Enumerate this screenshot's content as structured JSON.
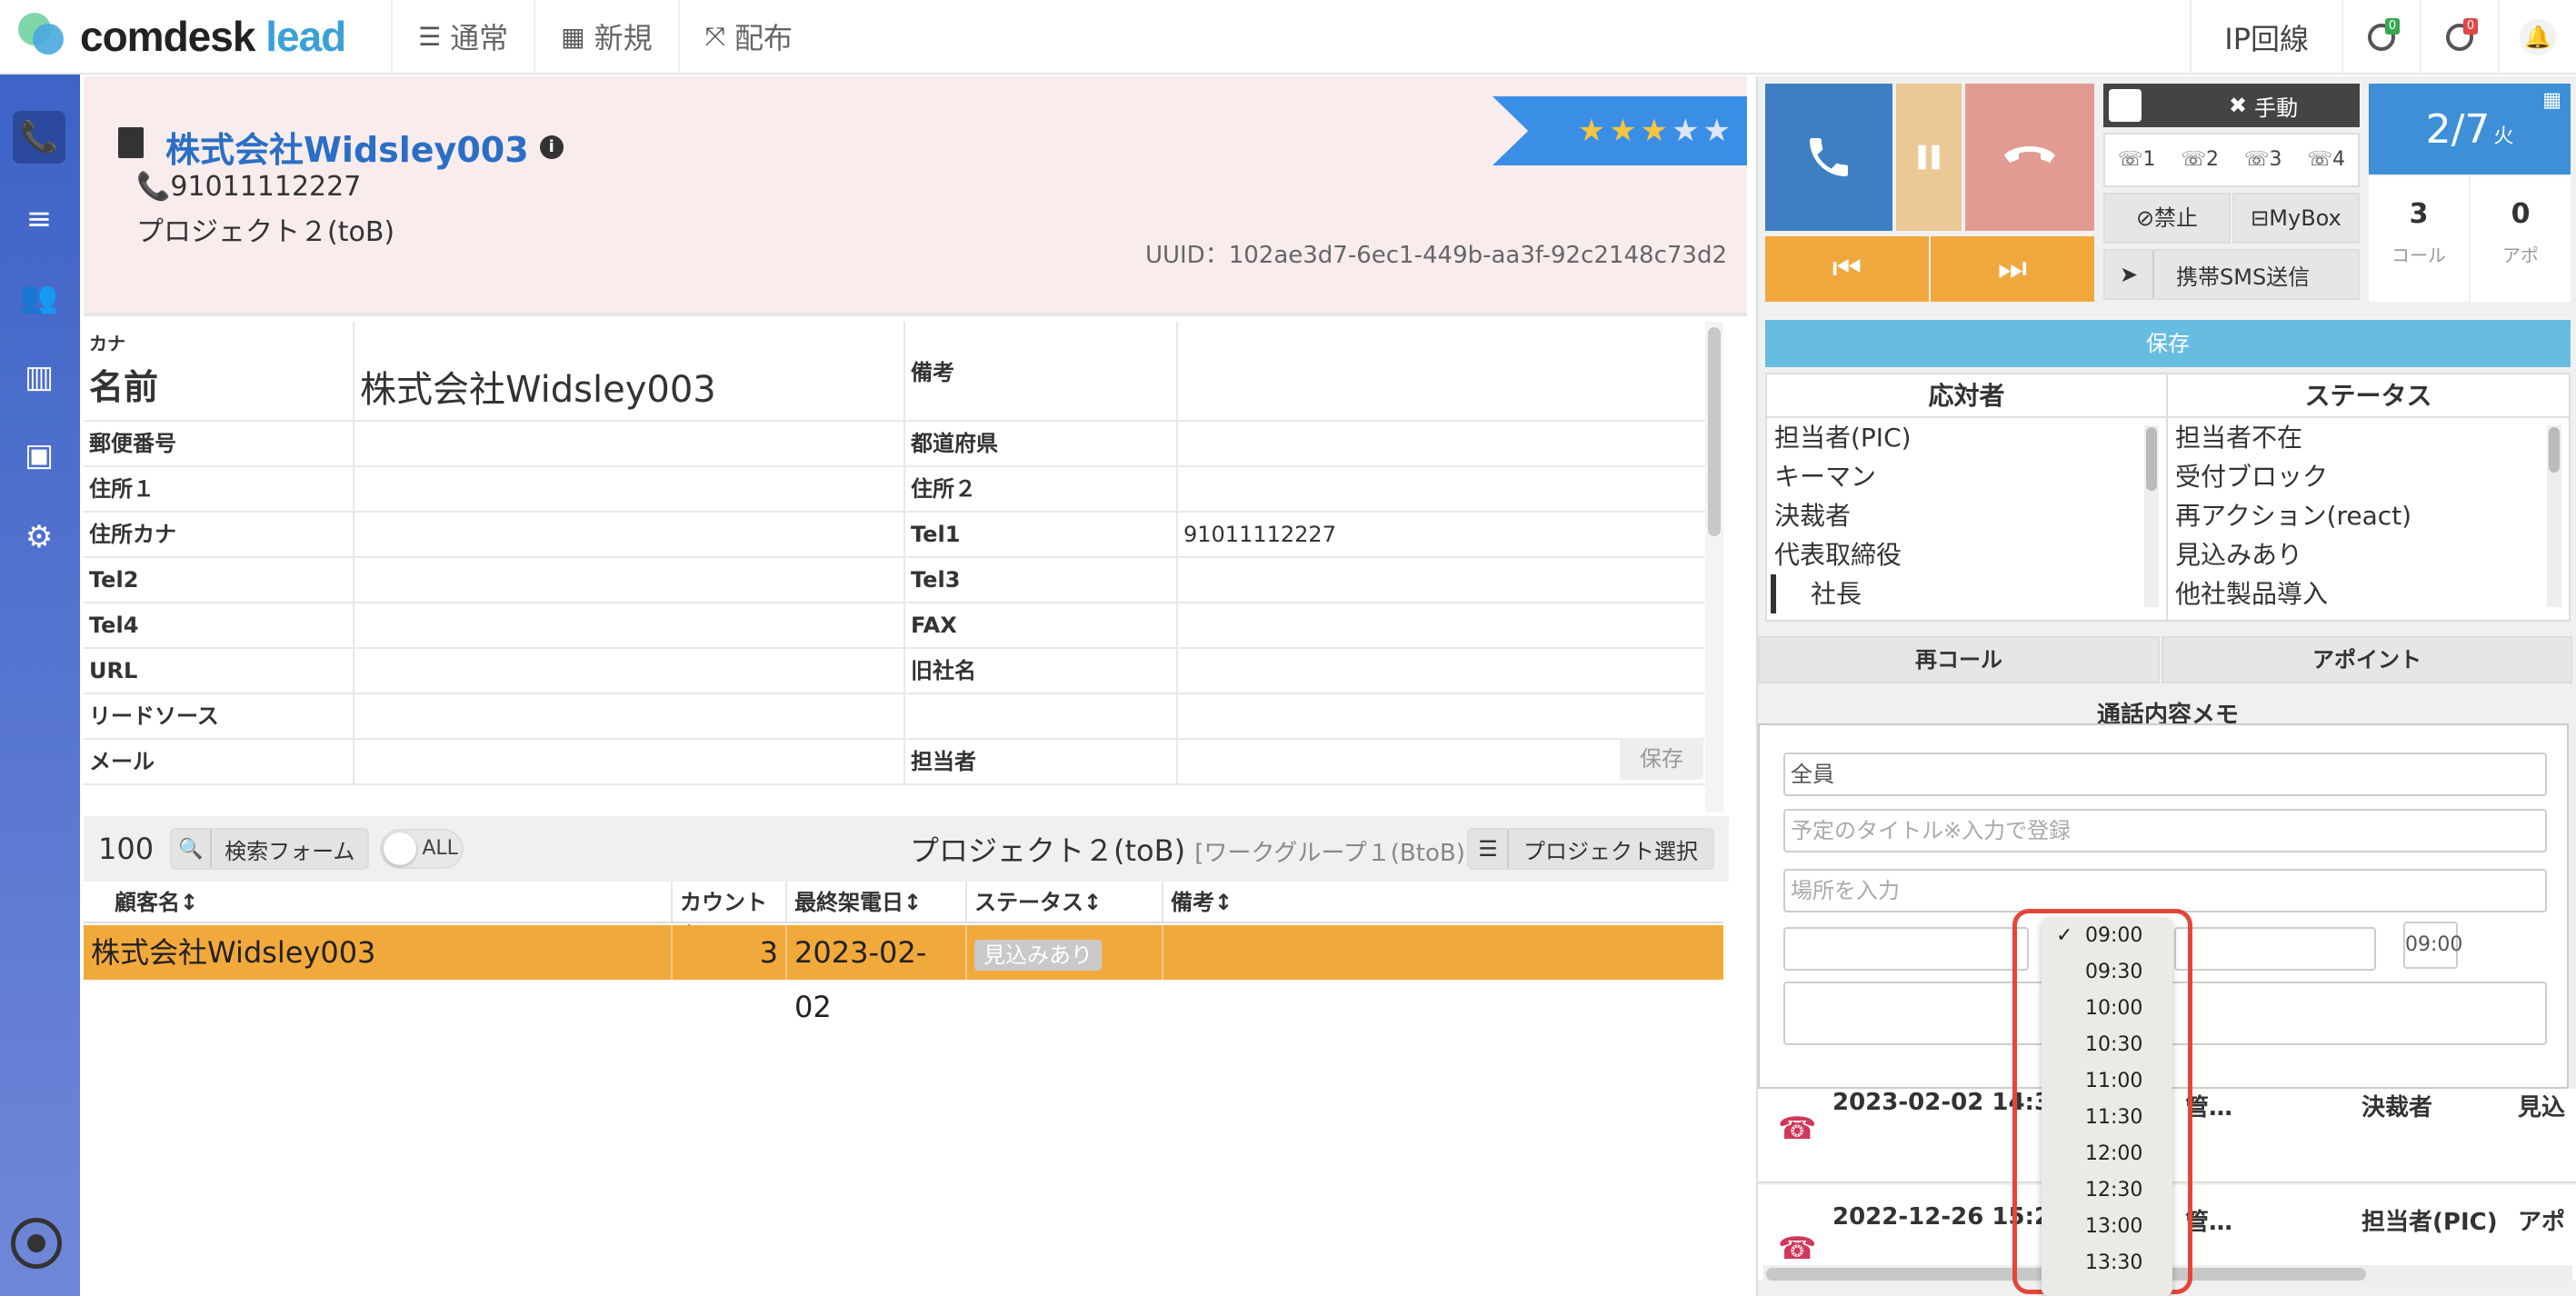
{
  "header": {
    "logo": {
      "comdesk": "comdesk",
      "lead": "lead"
    },
    "nav": [
      {
        "label": "通常",
        "icon": "list-icon"
      },
      {
        "label": "新規",
        "icon": "grid-icon"
      },
      {
        "label": "配布",
        "icon": "expand-icon"
      }
    ],
    "ip_line": "IP回線",
    "badges": [
      "0",
      "0"
    ],
    "colors": {
      "badge1": "#3aa851",
      "badge2": "#e04747"
    }
  },
  "company": {
    "name": "株式会社Widsley003",
    "tel": "91011112227",
    "project": "プロジェクト２(toB)",
    "uuid": "UUID：102ae3d7-6ec1-449b-aa3f-92c2148c73d2",
    "rating": 3,
    "rating_max": 5
  },
  "details": {
    "kana_label": "カナ",
    "name_label": "名前",
    "name_value": "株式会社Widsley003",
    "rows": [
      {
        "l1": "備考",
        "v1": "",
        "l2": "",
        "v2": ""
      },
      {
        "l1": "郵便番号",
        "v1": "",
        "l2": "都道府県",
        "v2": ""
      },
      {
        "l1": "住所１",
        "v1": "",
        "l2": "住所２",
        "v2": ""
      },
      {
        "l1": "住所カナ",
        "v1": "",
        "l2": "Tel1",
        "v2": "91011112227"
      },
      {
        "l1": "Tel2",
        "v1": "",
        "l2": "Tel3",
        "v2": ""
      },
      {
        "l1": "Tel4",
        "v1": "",
        "l2": "FAX",
        "v2": ""
      },
      {
        "l1": "URL",
        "v1": "",
        "l2": "旧社名",
        "v2": ""
      },
      {
        "l1": "リードソース",
        "v1": "",
        "l2": "",
        "v2": ""
      },
      {
        "l1": "メール",
        "v1": "",
        "l2": "担当者",
        "v2": ""
      }
    ],
    "save_label": "保存"
  },
  "list_toolbar": {
    "count": "100",
    "search_label": "検索フォーム",
    "all_label": "ALL",
    "project_title": "プロジェクト２(toB)",
    "workgroup": "[ワークグループ１(BtoB)]",
    "project_select": "プロジェクト選択"
  },
  "list": {
    "columns": [
      "顧客名↕",
      "カウント↕",
      "最終架電日↕",
      "ステータス↕",
      "備考↕"
    ],
    "rows": [
      {
        "name": "株式会社Widsley003",
        "count": "3",
        "date": "2023-02-02",
        "status": "見込みあり",
        "note": ""
      }
    ]
  },
  "call_panel": {
    "manual_label": "手動",
    "lines": [
      "1",
      "2",
      "3",
      "4"
    ],
    "ban_label": "禁止",
    "mybox_label": "MyBox",
    "sms_label": "携帯SMS送信",
    "date": "2/7",
    "weekday": "火",
    "calls": "3",
    "calls_label": "コール",
    "appts": "0",
    "appts_label": "アポ",
    "save_label": "保存"
  },
  "responder": {
    "header": "応対者",
    "items": [
      "担当者(PIC)",
      "キーマン",
      "決裁者",
      "代表取締役",
      "社長"
    ]
  },
  "status": {
    "header": "ステータス",
    "items": [
      "担当者不在",
      "受付ブロック",
      "再アクション(react)",
      "見込みあり",
      "他社製品導入"
    ]
  },
  "actions": {
    "recall": "再コール",
    "appoint": "アポイント"
  },
  "memo": {
    "title": "通話内容メモ",
    "assignee": "全員",
    "title_placeholder": "予定のタイトル※入力で登録",
    "place_placeholder": "場所を入力",
    "end_time": "09:00"
  },
  "history": [
    {
      "datetime": "2023-02-02 14:37:…",
      "user": "管…",
      "role": "決裁者",
      "result": "見込"
    },
    {
      "datetime": "2022-12-26 15:29:…",
      "user": "管…",
      "role": "担当者(PIC)",
      "result": "アポ"
    }
  ],
  "dropdown": {
    "selected": "09:00",
    "options": [
      "09:00",
      "09:30",
      "10:00",
      "10:30",
      "11:00",
      "11:30",
      "12:00",
      "12:30",
      "13:00",
      "13:30"
    ]
  }
}
